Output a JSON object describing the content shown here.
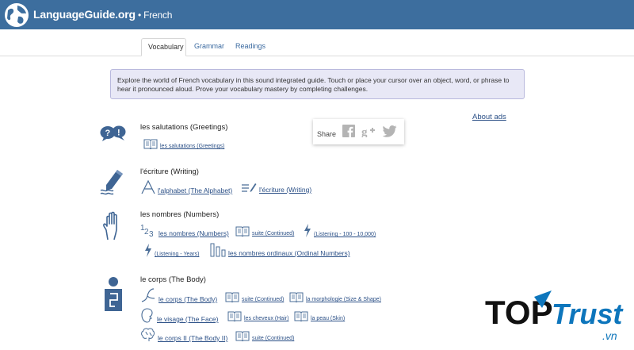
{
  "header": {
    "brand": "LanguageGuide.org",
    "separator": " • ",
    "language": "French"
  },
  "tabs": [
    {
      "label": "Vocabulary",
      "active": true
    },
    {
      "label": "Grammar",
      "active": false
    },
    {
      "label": "Readings",
      "active": false
    }
  ],
  "intro": "Explore the world of French vocabulary in this sound integrated guide. Touch or place your cursor over an object, word, or phrase to hear it pronounced aloud. Prove your vocabulary mastery by completing challenges.",
  "about_ads": "About ads",
  "share": {
    "label": "Share",
    "icons": [
      "facebook-icon",
      "google-plus-icon",
      "twitter-icon"
    ]
  },
  "categories": [
    {
      "title": "les salutations (Greetings)",
      "icon": "speech-bubbles-icon",
      "items": [
        {
          "label": "les salutations (Greetings)",
          "icon": "book-icon"
        }
      ]
    },
    {
      "title": "l'écriture (Writing)",
      "icon": "pencil-icon",
      "items": [
        {
          "label": "l'alphabet (The Alphabet)",
          "icon": "letter-a-icon"
        },
        {
          "label": "l'écriture (Writing)",
          "icon": "writing-lines-icon"
        }
      ]
    },
    {
      "title": "les nombres (Numbers)",
      "icon": "hand-icon",
      "items": [
        {
          "label": "les nombres (Numbers)",
          "icon": "numbers-icon"
        },
        {
          "label": "suite (Continued)",
          "icon": "book-icon"
        },
        {
          "label": "(Listening - 100 - 10,000)",
          "icon": "lightning-icon"
        },
        {
          "label": "(Listening - Years)",
          "icon": "lightning-icon"
        },
        {
          "label": "les nombres ordinaux (Ordinal Numbers)",
          "icon": "bars-icon"
        }
      ]
    },
    {
      "title": "le corps (The Body)",
      "icon": "body-icon",
      "items": [
        {
          "label": "le corps (The Body)",
          "icon": "figure-icon"
        },
        {
          "label": "suite (Continued)",
          "icon": "book-icon"
        },
        {
          "label": "la morphologie (Size & Shape)",
          "icon": "book-icon"
        },
        {
          "label": "le visage (The Face)",
          "icon": "face-icon"
        },
        {
          "label": "les cheveux (Hair)",
          "icon": "book-icon"
        },
        {
          "label": "la peau (Skin)",
          "icon": "book-icon"
        },
        {
          "label": "le corps II (The Body II)",
          "icon": "brain-icon"
        },
        {
          "label": "suite (Continued)",
          "icon": "book-icon"
        }
      ]
    }
  ],
  "watermark": {
    "top": "TOP",
    "trust": "Trust",
    "suffix": ".vn"
  },
  "colors": {
    "header": "#3d6e9e",
    "link": "#2a4f86",
    "intro_bg": "#e8e8f6",
    "icon": "#4a6d97",
    "watermark_blue": "#0e76bc"
  }
}
